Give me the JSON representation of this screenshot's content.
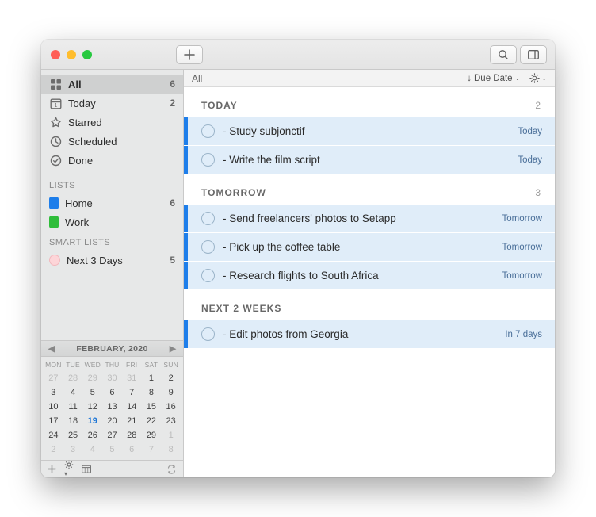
{
  "titlebar": {},
  "sidebar": {
    "smart": [
      {
        "icon": "grid",
        "label": "All",
        "count": "6",
        "selected": true
      },
      {
        "icon": "calendar",
        "label": "Today",
        "count": "2"
      },
      {
        "icon": "star",
        "label": "Starred",
        "count": ""
      },
      {
        "icon": "clock",
        "label": "Scheduled",
        "count": ""
      },
      {
        "icon": "check",
        "label": "Done",
        "count": ""
      }
    ],
    "lists_header": "LISTS",
    "lists": [
      {
        "color": "#1e7eea",
        "label": "Home",
        "count": "6"
      },
      {
        "color": "#2fbd3a",
        "label": "Work",
        "count": ""
      }
    ],
    "smartlists_header": "SMART LISTS",
    "smartlists": [
      {
        "label": "Next 3 Days",
        "count": "5"
      }
    ]
  },
  "calendar": {
    "title": "FEBRUARY, 2020",
    "weekdays": [
      "MON",
      "TUE",
      "WED",
      "THU",
      "FRI",
      "SAT",
      "SUN"
    ],
    "cells": [
      {
        "n": "27",
        "off": true
      },
      {
        "n": "28",
        "off": true
      },
      {
        "n": "29",
        "off": true
      },
      {
        "n": "30",
        "off": true
      },
      {
        "n": "31",
        "off": true
      },
      {
        "n": "1"
      },
      {
        "n": "2"
      },
      {
        "n": "3"
      },
      {
        "n": "4"
      },
      {
        "n": "5"
      },
      {
        "n": "6"
      },
      {
        "n": "7"
      },
      {
        "n": "8"
      },
      {
        "n": "9"
      },
      {
        "n": "10"
      },
      {
        "n": "11"
      },
      {
        "n": "12"
      },
      {
        "n": "13"
      },
      {
        "n": "14"
      },
      {
        "n": "15"
      },
      {
        "n": "16"
      },
      {
        "n": "17"
      },
      {
        "n": "18"
      },
      {
        "n": "19",
        "today": true
      },
      {
        "n": "20"
      },
      {
        "n": "21"
      },
      {
        "n": "22"
      },
      {
        "n": "23"
      },
      {
        "n": "24"
      },
      {
        "n": "25"
      },
      {
        "n": "26"
      },
      {
        "n": "27"
      },
      {
        "n": "28"
      },
      {
        "n": "29"
      },
      {
        "n": "1",
        "off": true
      },
      {
        "n": "2",
        "off": true
      },
      {
        "n": "3",
        "off": true
      },
      {
        "n": "4",
        "off": true
      },
      {
        "n": "5",
        "off": true
      },
      {
        "n": "6",
        "off": true
      },
      {
        "n": "7",
        "off": true
      },
      {
        "n": "8",
        "off": true
      }
    ]
  },
  "filter": {
    "scope": "All",
    "sort_label": "Due Date"
  },
  "sections": [
    {
      "title": "TODAY",
      "count": "2",
      "tasks": [
        {
          "text": "- Study subjonctif",
          "due": "Today"
        },
        {
          "text": "- Write the film script",
          "due": "Today"
        }
      ]
    },
    {
      "title": "TOMORROW",
      "count": "3",
      "tasks": [
        {
          "text": "- Send freelancers' photos to Setapp",
          "due": "Tomorrow"
        },
        {
          "text": "- Pick up the coffee table",
          "due": "Tomorrow"
        },
        {
          "text": "- Research flights to South Africa",
          "due": "Tomorrow"
        }
      ]
    },
    {
      "title": "NEXT 2 WEEKS",
      "count": "",
      "tasks": [
        {
          "text": "- Edit photos from Georgia",
          "due": "In 7 days"
        }
      ]
    }
  ]
}
